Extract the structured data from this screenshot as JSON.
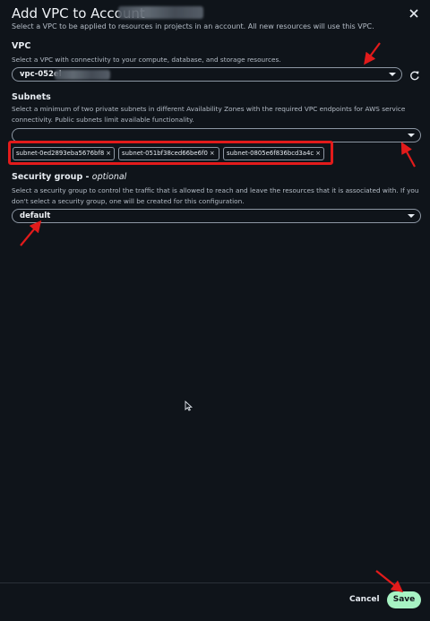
{
  "dialog": {
    "title": "Add VPC to Account",
    "subtitle": "Select a VPC to be applied to resources in projects in an account. All new resources will use this VPC."
  },
  "vpc": {
    "label": "VPC",
    "description": "Select a VPC with connectivity to your compute, database, and storage resources.",
    "value": "vpc-052el"
  },
  "subnets": {
    "label": "Subnets",
    "description": "Select a minimum of two private subnets in different Availability Zones with the required VPC endpoints for AWS service connectivity. Public subnets limit available functionality.",
    "value": "",
    "tokens": [
      "subnet-0ed2893eba5676bf8",
      "subnet-051bf38ced66be6f0",
      "subnet-0805e6f836bcd3a4c"
    ],
    "token_remove": "×"
  },
  "security_group": {
    "label": "Security group - ",
    "optional": "optional",
    "description": "Select a security group to control the traffic that is allowed to reach and leave the resources that it is associated with. If you don't select a security group, one will be created for this configuration.",
    "value": "default"
  },
  "footer": {
    "cancel_label": "Cancel",
    "save_label": "Save"
  },
  "colors": {
    "background": "#0f141a",
    "annotation": "#e21b1b",
    "save": "#a7f3c4"
  },
  "icons": [
    "close-icon",
    "refresh-icon",
    "chevron-down-icon",
    "remove-icon",
    "mouse-cursor-icon",
    "annotation-arrow"
  ]
}
